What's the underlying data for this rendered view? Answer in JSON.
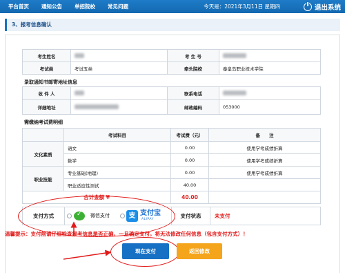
{
  "nav": {
    "items": [
      "平台首页",
      "通知公告",
      "单招院校",
      "常见问题"
    ],
    "date": "今天是：2021年3月11日 星期四",
    "logout": "退出系统"
  },
  "section_title": "3、报考信息确认",
  "exam_info": {
    "name_label": "考生姓名",
    "number_label": "考 生 号",
    "category_label": "考试类",
    "category_value": "考试五类",
    "school_label": "牵头院校",
    "school_value": "秦皇岛职业技术学院"
  },
  "mail_info": {
    "title": "录取通知书邮寄地址信息",
    "recipient_label": "收 件 人",
    "phone_label": "联系电话",
    "address_label": "详细地址",
    "zip_label": "邮政编码",
    "zip_value": "053000"
  },
  "fees": {
    "title": "需缴纳考试费明细",
    "headers": [
      "考试科目",
      "考试费（元）",
      "备　　注"
    ],
    "groups": [
      {
        "name": "文化素质",
        "rows": [
          {
            "subject": "语文",
            "fee": "0.00",
            "note": "使用学考成绩折算"
          },
          {
            "subject": "数学",
            "fee": "0.00",
            "note": "使用学考成绩折算"
          }
        ]
      },
      {
        "name": "职业技能",
        "rows": [
          {
            "subject": "专业基础(地理)",
            "fee": "0.00",
            "note": "使用学考成绩折算"
          },
          {
            "subject": "职业适应性测试",
            "fee": "40.00",
            "note": ""
          }
        ]
      }
    ],
    "total_label": "合计金额 ¥",
    "total_value": "40.00"
  },
  "payment": {
    "method_label": "支付方式",
    "wechat_label": "微信支付",
    "alipay_label": "支付宝",
    "alipay_sub": "ALIPAY",
    "status_label": "支付状态",
    "status_value": "未支付"
  },
  "warning": "温馨提示：支付前请仔细检查报考信息是否正确，一旦确定支付，将无法修改任何信息（包含支付方式）！",
  "buttons": {
    "pay": "现在支付",
    "back": "返回修改"
  },
  "colors": {
    "topbar": "#1870c0",
    "accent_red": "#e21a1a",
    "pay_button": "#1670c4",
    "back_button": "#f4a51c"
  }
}
